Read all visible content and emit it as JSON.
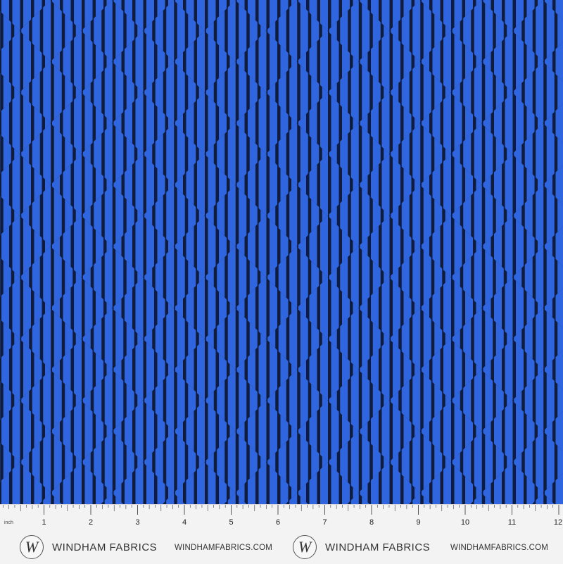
{
  "fabric": {
    "pattern": "striped-diamond-checker",
    "colors": {
      "background": "#111c3c",
      "stripe": "#2f66e0"
    }
  },
  "ruler": {
    "unit_label": "inch",
    "numbers": [
      "1",
      "2",
      "3",
      "4",
      "5",
      "6",
      "7",
      "8",
      "9",
      "10",
      "11",
      "12"
    ],
    "brand_left": {
      "logo_letter": "W",
      "name": "WINDHAM FABRICS",
      "url": "WINDHAMFABRICS.COM"
    },
    "brand_right": {
      "logo_letter": "W",
      "name": "WINDHAM FABRICS",
      "url": "WINDHAMFABRICS.COM"
    }
  }
}
